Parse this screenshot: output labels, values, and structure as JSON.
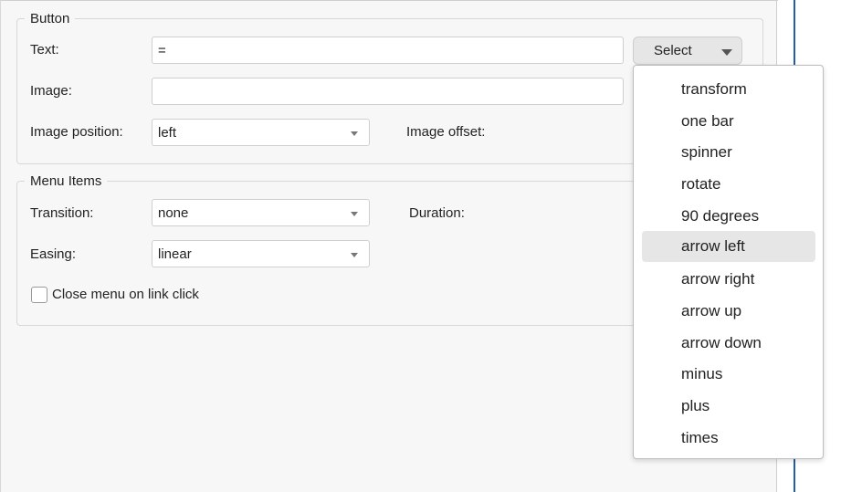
{
  "button_group": {
    "legend": "Button",
    "text_label": "Text:",
    "text_value": "=",
    "select_label": "Select",
    "image_label": "Image:",
    "image_value": "",
    "image_position_label": "Image position:",
    "image_position_value": "left",
    "image_offset_label": "Image offset:"
  },
  "menu_group": {
    "legend": "Menu Items",
    "transition_label": "Transition:",
    "transition_value": "none",
    "duration_label": "Duration:",
    "easing_label": "Easing:",
    "easing_value": "linear",
    "close_menu_label": "Close menu on link click",
    "close_menu_checked": false
  },
  "dropdown": {
    "highlighted": "arrow left",
    "items": [
      "transform",
      "one bar",
      "spinner",
      "rotate",
      "90 degrees",
      "arrow left",
      "arrow right",
      "arrow up",
      "arrow down",
      "minus",
      "plus",
      "times"
    ]
  },
  "colors": {
    "panel_bg": "#f7f7f7",
    "border": "#d7d7d7",
    "accent_line": "#1f5fa8",
    "highlight": "#e6e6e6"
  },
  "icons": {
    "dropdown_caret": "caret-down-icon",
    "checkbox": "checkbox-unchecked-icon"
  }
}
